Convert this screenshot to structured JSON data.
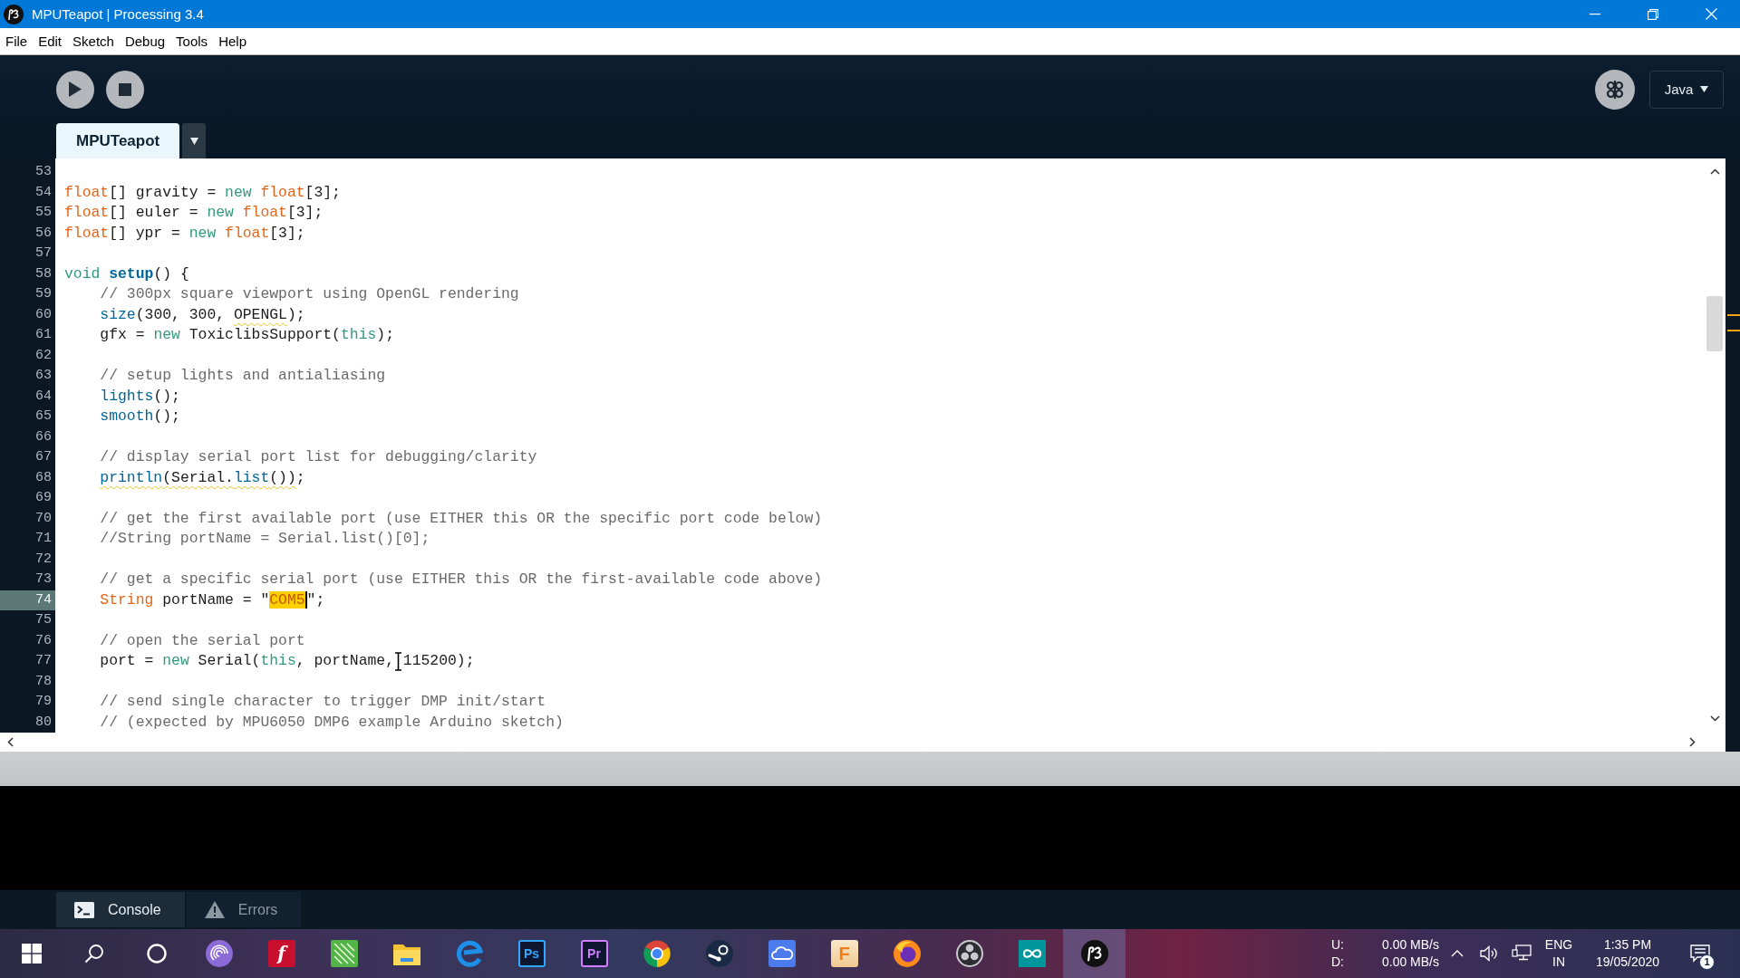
{
  "window": {
    "title": "MPUTeapot | Processing 3.4"
  },
  "menu": [
    "File",
    "Edit",
    "Sketch",
    "Debug",
    "Tools",
    "Help"
  ],
  "toolbar": {
    "mode": "Java"
  },
  "tabs": [
    {
      "label": "MPUTeapot",
      "selected": true
    }
  ],
  "editor": {
    "lines": [
      {
        "number": "53",
        "current": false
      },
      {
        "number": "54",
        "current": false,
        "indented": false,
        "tokens": [
          {
            "kind": "type",
            "text": "float"
          },
          {
            "kind": "plain",
            "text": "[] gravity = "
          },
          {
            "kind": "keyword",
            "text": "new"
          },
          {
            "kind": "type",
            "text": " float"
          },
          {
            "kind": "plain",
            "text": "[3];"
          }
        ]
      },
      {
        "number": "55",
        "current": false,
        "indented": false,
        "tokens": [
          {
            "kind": "type",
            "text": "float"
          },
          {
            "kind": "plain",
            "text": "[] euler = "
          },
          {
            "kind": "keyword",
            "text": "new"
          },
          {
            "kind": "type",
            "text": " float"
          },
          {
            "kind": "plain",
            "text": "[3];"
          }
        ]
      },
      {
        "number": "56",
        "current": false,
        "indented": false,
        "tokens": [
          {
            "kind": "type",
            "text": "float"
          },
          {
            "kind": "plain",
            "text": "[] ypr = "
          },
          {
            "kind": "keyword",
            "text": "new"
          },
          {
            "kind": "type",
            "text": " float"
          },
          {
            "kind": "plain",
            "text": "[3];"
          }
        ]
      },
      {
        "number": "57",
        "current": false
      },
      {
        "number": "58",
        "current": false,
        "indented": false,
        "tokens": [
          {
            "kind": "keyword",
            "text": "void"
          },
          {
            "kind": "definition",
            "text": " setup"
          },
          {
            "kind": "plain",
            "text": "() {"
          }
        ]
      },
      {
        "number": "59",
        "current": false,
        "indented": true,
        "tokens": [
          {
            "kind": "comment",
            "text": "// 300px square viewport using OpenGL rendering"
          }
        ]
      },
      {
        "number": "60",
        "current": false,
        "indented": true,
        "tokens": [
          {
            "kind": "function",
            "text": "size"
          },
          {
            "kind": "plain",
            "text": "(300, 300, "
          },
          {
            "kind": "warning",
            "tokens": [
              {
                "kind": "plain",
                "text": "OPENGL"
              }
            ]
          },
          {
            "kind": "plain",
            "text": ");"
          }
        ]
      },
      {
        "number": "61",
        "current": false,
        "indented": true,
        "tokens": [
          {
            "kind": "plain",
            "text": "gfx = "
          },
          {
            "kind": "keyword",
            "text": "new"
          },
          {
            "kind": "plain",
            "text": " ToxiclibsSupport("
          },
          {
            "kind": "keyword",
            "text": "this"
          },
          {
            "kind": "plain",
            "text": ");"
          }
        ]
      },
      {
        "number": "62",
        "current": false
      },
      {
        "number": "63",
        "current": false,
        "indented": true,
        "tokens": [
          {
            "kind": "comment",
            "text": "// setup lights and antialiasing"
          }
        ]
      },
      {
        "number": "64",
        "current": false,
        "indented": true,
        "tokens": [
          {
            "kind": "function",
            "text": "lights"
          },
          {
            "kind": "plain",
            "text": "();"
          }
        ]
      },
      {
        "number": "65",
        "current": false,
        "indented": true,
        "tokens": [
          {
            "kind": "function",
            "text": "smooth"
          },
          {
            "kind": "plain",
            "text": "();"
          }
        ]
      },
      {
        "number": "66",
        "current": false
      },
      {
        "number": "67",
        "current": false,
        "indented": true,
        "tokens": [
          {
            "kind": "comment",
            "text": "// display serial port list for debugging/clarity"
          }
        ]
      },
      {
        "number": "68",
        "current": false,
        "indented": true,
        "tokens": [
          {
            "kind": "warning",
            "tokens": [
              {
                "kind": "function",
                "text": "println"
              },
              {
                "kind": "plain",
                "text": "(Serial."
              },
              {
                "kind": "function",
                "text": "list"
              },
              {
                "kind": "plain",
                "text": "())"
              }
            ]
          },
          {
            "kind": "plain",
            "text": ";"
          }
        ]
      },
      {
        "number": "69",
        "current": false
      },
      {
        "number": "70",
        "current": false,
        "indented": true,
        "tokens": [
          {
            "kind": "comment",
            "text": "// get the first available port (use EITHER this OR the specific port code below)"
          }
        ]
      },
      {
        "number": "71",
        "current": false,
        "indented": true,
        "tokens": [
          {
            "kind": "comment",
            "text": "//String portName = Serial.list()[0];"
          }
        ]
      },
      {
        "number": "72",
        "current": false
      },
      {
        "number": "73",
        "current": false,
        "indented": true,
        "tokens": [
          {
            "kind": "comment",
            "text": "// get a specific serial port (use EITHER this OR the first-available code above)"
          }
        ]
      },
      {
        "number": "74",
        "current": true,
        "indented": true,
        "tokens": [
          {
            "kind": "type",
            "text": "String"
          },
          {
            "kind": "plain",
            "text": " portName = \""
          },
          {
            "kind": "match",
            "text": "COM5"
          },
          {
            "kind": "caret"
          },
          {
            "kind": "plain",
            "text": "\";"
          }
        ]
      },
      {
        "number": "75",
        "current": false
      },
      {
        "number": "76",
        "current": false,
        "indented": true,
        "tokens": [
          {
            "kind": "comment",
            "text": "// open the serial port"
          }
        ]
      },
      {
        "number": "77",
        "current": false,
        "indented": true,
        "tokens": [
          {
            "kind": "plain",
            "text": "port = "
          },
          {
            "kind": "keyword",
            "text": "new"
          },
          {
            "kind": "plain",
            "text": " Serial("
          },
          {
            "kind": "keyword",
            "text": "this"
          },
          {
            "kind": "plain",
            "text": ", portName,"
          },
          {
            "kind": "pointer"
          },
          {
            "kind": "plain",
            "text": "115200);"
          }
        ]
      },
      {
        "number": "78",
        "current": false
      },
      {
        "number": "79",
        "current": false,
        "indented": true,
        "tokens": [
          {
            "kind": "comment",
            "text": "// send single character to trigger DMP init/start"
          }
        ]
      },
      {
        "number": "80",
        "current": false,
        "indented": true,
        "tokens": [
          {
            "kind": "comment",
            "text": "// (expected by MPU6050 DMP6 example Arduino sketch)"
          }
        ]
      }
    ]
  },
  "console": {
    "tabs": [
      {
        "kind": "console",
        "label": "Console",
        "selected": true
      },
      {
        "kind": "errors",
        "label": "Errors",
        "selected": false
      }
    ]
  },
  "taskbar": {
    "apps": [
      {
        "kind": "spiral",
        "active": false
      },
      {
        "kind": "filled-tile",
        "glyph": "f",
        "color": "#c8102e",
        "active": false
      },
      {
        "kind": "striped",
        "active": false
      },
      {
        "kind": "folder",
        "active": false
      },
      {
        "kind": "swirl",
        "active": false
      },
      {
        "kind": "outlined-tile",
        "glyph": "Ps",
        "color": "#31a8ff",
        "active": false
      },
      {
        "kind": "outlined-tile",
        "glyph": "Pr",
        "color": "#d27cff",
        "active": false
      },
      {
        "kind": "pinwheel",
        "active": false
      },
      {
        "kind": "disc",
        "active": false
      },
      {
        "kind": "cloud",
        "active": false
      },
      {
        "kind": "light-tile",
        "glyph": "F",
        "color": "#f07d1a",
        "active": false
      },
      {
        "kind": "globe",
        "active": false
      },
      {
        "kind": "aperture",
        "active": false
      },
      {
        "kind": "infinity",
        "active": false
      },
      {
        "kind": "logo",
        "active": true
      }
    ],
    "tray": {
      "upload_label": "U:",
      "download_label": "D:",
      "upload": "0.00 MB/s",
      "download": "0.00 MB/s",
      "language": "ENG",
      "region": "IN",
      "time": "1:35 PM",
      "date": "19/05/2020",
      "notifications": "1"
    }
  }
}
